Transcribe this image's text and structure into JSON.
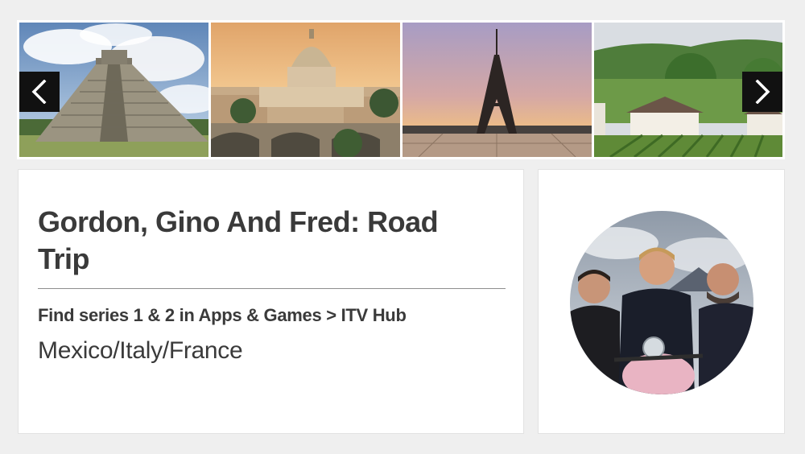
{
  "carousel": {
    "slides": [
      {
        "subject": "Mexico pyramid"
      },
      {
        "subject": "Vatican Rome"
      },
      {
        "subject": "Eiffel Tower Paris"
      },
      {
        "subject": "French countryside vineyard"
      }
    ],
    "prev_icon": "chevron-left-icon",
    "next_icon": "chevron-right-icon"
  },
  "show": {
    "title": "Gordon, Gino And Fred: Road Trip",
    "subtitle": "Find series 1 & 2 in Apps & Games > ITV Hub",
    "locations": "Mexico/Italy/France"
  },
  "colors": {
    "background": "#efefef",
    "card": "#ffffff",
    "text": "#3a3a3a",
    "arrow": "#111111"
  }
}
